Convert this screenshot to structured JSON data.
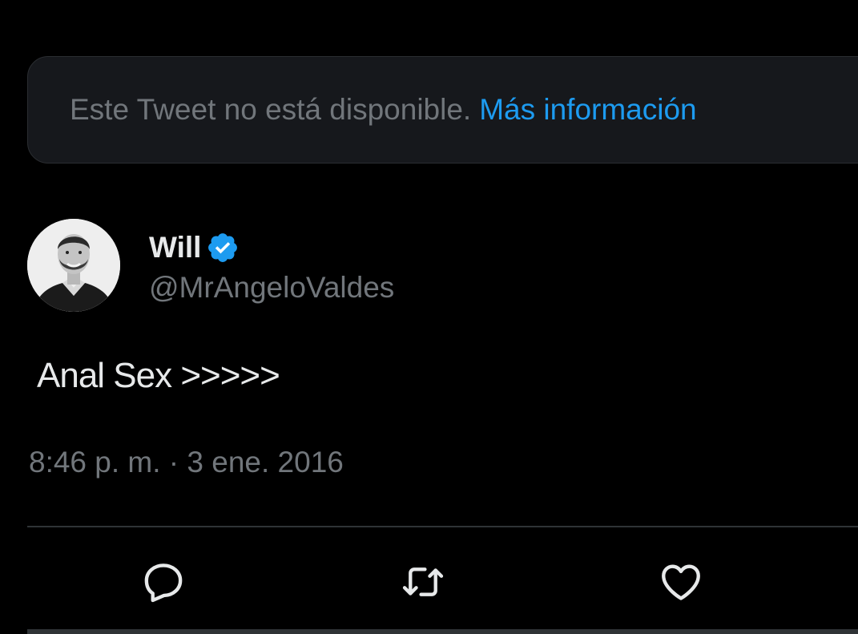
{
  "notice": {
    "text": "Este Tweet no está disponible.",
    "link": "Más información"
  },
  "author": {
    "display_name": "Will",
    "handle": "@MrAngeloValdes",
    "verified_icon": "verified-badge-icon",
    "avatar": "profile-photo"
  },
  "tweet": {
    "text": "Anal Sex >>>>>",
    "timestamp": "8:46 p. m. · 3 ene. 2016"
  },
  "actions": [
    {
      "icon": "reply-icon"
    },
    {
      "icon": "retweet-icon"
    },
    {
      "icon": "like-icon"
    }
  ],
  "colors": {
    "background": "#000000",
    "card": "#16181c",
    "text_primary": "#e7e9ea",
    "text_secondary": "#71767b",
    "accent": "#1d9bf0",
    "divider": "#2f3336"
  }
}
